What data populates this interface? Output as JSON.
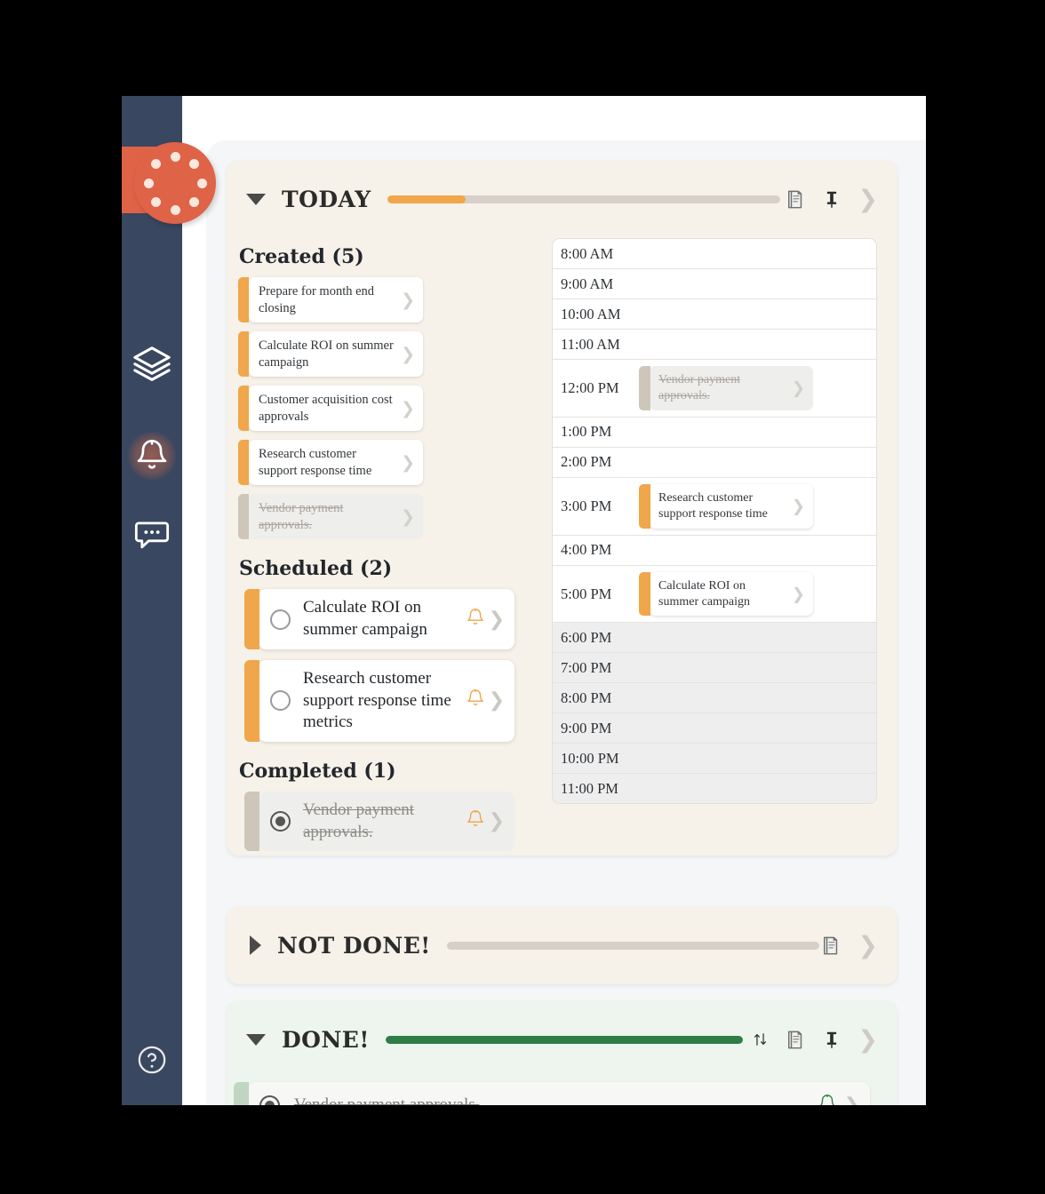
{
  "colors": {
    "sidebar": "#3A4760",
    "logo": "#DF6347",
    "accent_orange": "#F0A64A",
    "progress_track": "#D6D0C8",
    "done_green": "#2E7D46",
    "card_cream": "#F6F1E9",
    "card_done": "#EDF5EE"
  },
  "sidebar": {
    "logo": {
      "name": "app-logo",
      "dots": 8
    },
    "items": [
      {
        "icon": "layers-icon",
        "label": "Layers",
        "active": false
      },
      {
        "icon": "bell-icon",
        "label": "Notifications",
        "active": true
      },
      {
        "icon": "chat-bubble-icon",
        "label": "Messages",
        "active": false
      }
    ],
    "help": {
      "icon": "help-circle-icon",
      "label": "Help"
    }
  },
  "sections": [
    {
      "id": "today",
      "title": "TODAY",
      "expanded": true,
      "collapse_icon": "triangle-down-icon",
      "progress_percent": 20,
      "progress_color": "#F0A64A",
      "actions": [
        "book-icon",
        "pin-icon",
        "chevron-right-icon"
      ]
    },
    {
      "id": "not-done",
      "title": "NOT DONE!",
      "expanded": false,
      "collapse_icon": "triangle-right-icon",
      "progress_percent": 0,
      "progress_color": "#F0A64A",
      "actions": [
        "book-icon",
        "chevron-right-icon"
      ]
    },
    {
      "id": "done",
      "title": "DONE!",
      "expanded": true,
      "collapse_icon": "triangle-down-icon",
      "progress_percent": 100,
      "progress_color": "#2E7D46",
      "actions": [
        "sort-icon",
        "book-icon",
        "pin-icon",
        "chevron-right-icon"
      ]
    }
  ],
  "today": {
    "created": {
      "heading": "Created (5)",
      "items": [
        {
          "text": "Prepare for month end closing",
          "completed": false
        },
        {
          "text": "Calculate ROI on summer campaign",
          "completed": false
        },
        {
          "text": "Customer acquisition cost approvals",
          "completed": false
        },
        {
          "text": "Research customer support response time",
          "completed": false
        },
        {
          "text": "Vendor payment approvals.",
          "completed": true
        }
      ]
    },
    "scheduled": {
      "heading": "Scheduled (2)",
      "items": [
        {
          "text": "Calculate ROI on summer campaign",
          "checked": false,
          "bell": "bell-icon"
        },
        {
          "text": "Research customer support response time metrics",
          "checked": false,
          "bell": "bell-icon"
        }
      ]
    },
    "completed": {
      "heading": "Completed (1)",
      "items": [
        {
          "text": "Vendor payment approvals.",
          "checked": true,
          "bell": "bell-icon"
        }
      ]
    },
    "timeline": [
      {
        "time": "8:00 AM",
        "dim": false,
        "event": null
      },
      {
        "time": "9:00 AM",
        "dim": false,
        "event": null
      },
      {
        "time": "10:00 AM",
        "dim": false,
        "event": null
      },
      {
        "time": "11:00 AM",
        "dim": false,
        "event": null
      },
      {
        "time": "12:00 PM",
        "dim": false,
        "event": {
          "text": "Vendor payment approvals.",
          "completed": true
        }
      },
      {
        "time": "1:00 PM",
        "dim": false,
        "event": null
      },
      {
        "time": "2:00 PM",
        "dim": false,
        "event": null
      },
      {
        "time": "3:00 PM",
        "dim": false,
        "event": {
          "text": "Research customer support response time",
          "completed": false
        }
      },
      {
        "time": "4:00 PM",
        "dim": false,
        "event": null
      },
      {
        "time": "5:00 PM",
        "dim": false,
        "event": {
          "text": "Calculate ROI on summer campaign",
          "completed": false
        }
      },
      {
        "time": "6:00 PM",
        "dim": true,
        "event": null
      },
      {
        "time": "7:00 PM",
        "dim": true,
        "event": null
      },
      {
        "time": "8:00 PM",
        "dim": true,
        "event": null
      },
      {
        "time": "9:00 PM",
        "dim": true,
        "event": null
      },
      {
        "time": "10:00 PM",
        "dim": true,
        "event": null
      },
      {
        "time": "11:00 PM",
        "dim": true,
        "event": null
      }
    ]
  },
  "done_section": {
    "items": [
      {
        "text": "Vendor payment approvals.",
        "checked": true,
        "bell": "bell-icon"
      }
    ]
  }
}
